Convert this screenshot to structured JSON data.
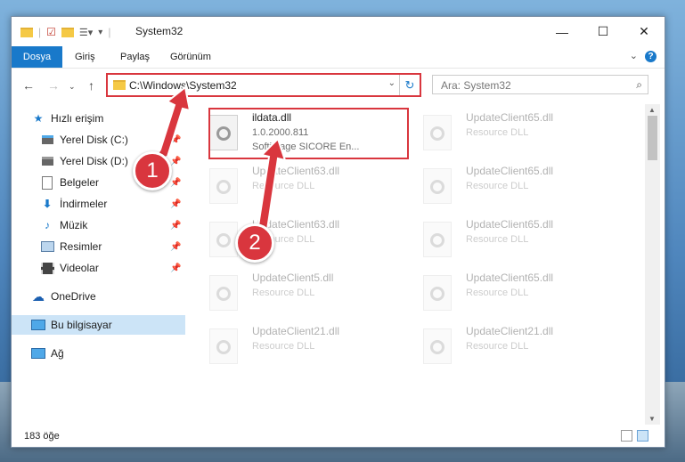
{
  "window": {
    "title": "System32",
    "controls": {
      "minimize": "—",
      "maximize": "☐",
      "close": "✕"
    }
  },
  "ribbon": {
    "tabs": [
      "Dosya",
      "Giriş",
      "Paylaş",
      "Görünüm"
    ],
    "help": "?"
  },
  "address": {
    "path": "C:\\Windows\\System32",
    "search_placeholder": "Ara: System32"
  },
  "sidebar": {
    "items": [
      {
        "label": "Hızlı erişim",
        "icon": "star-icon"
      },
      {
        "label": "Yerel Disk (C:)",
        "icon": "drive-icon",
        "pinned": true
      },
      {
        "label": "Yerel Disk (D:)",
        "icon": "drive-icon",
        "pinned": true
      },
      {
        "label": "Belgeler",
        "icon": "document-icon",
        "pinned": true
      },
      {
        "label": "İndirmeler",
        "icon": "download-icon",
        "pinned": true
      },
      {
        "label": "Müzik",
        "icon": "music-icon",
        "pinned": true
      },
      {
        "label": "Resimler",
        "icon": "pictures-icon",
        "pinned": true
      },
      {
        "label": "Videolar",
        "icon": "video-icon",
        "pinned": true
      },
      {
        "label": "OneDrive",
        "icon": "cloud-icon"
      },
      {
        "label": "Bu bilgisayar",
        "icon": "computer-icon",
        "selected": true
      },
      {
        "label": "Ağ",
        "icon": "network-icon"
      }
    ]
  },
  "files": [
    {
      "name": "ildata.dll",
      "line2": "1.0.2000.811",
      "line3": "Softimage SICORE En...",
      "highlighted": true
    },
    {
      "name": "UpdateClient65.dll",
      "line2": "Resource DLL"
    },
    {
      "name": "UpdateClient63.dll",
      "line2": "Resource DLL"
    },
    {
      "name": "UpdateClient65.dll",
      "line2": "Resource DLL"
    },
    {
      "name": "UpdateClient63.dll",
      "line2": "Resource DLL"
    },
    {
      "name": "UpdateClient65.dll",
      "line2": "Resource DLL"
    },
    {
      "name": "UpdateClient5.dll",
      "line2": "Resource DLL"
    },
    {
      "name": "UpdateClient65.dll",
      "line2": "Resource DLL"
    },
    {
      "name": "UpdateClient21.dll",
      "line2": "Resource DLL"
    },
    {
      "name": "UpdateClient21.dll",
      "line2": "Resource DLL"
    }
  ],
  "status": {
    "count": "183 öğe"
  },
  "callouts": {
    "one": "1",
    "two": "2"
  },
  "colors": {
    "accent": "#1979ca",
    "highlight": "#d9363e",
    "selected": "#cce4f7"
  }
}
